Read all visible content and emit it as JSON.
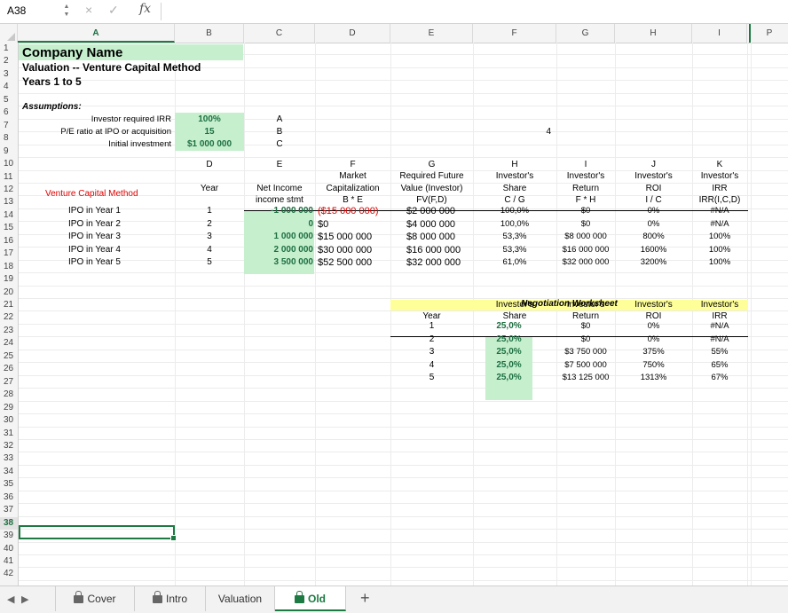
{
  "formula_bar": {
    "name_box": "A38",
    "cancel_icon": "×",
    "enter_icon": "✓",
    "fx_label": "fx",
    "formula": ""
  },
  "columns": [
    "A",
    "B",
    "C",
    "D",
    "E",
    "F",
    "G",
    "H",
    "I",
    "P"
  ],
  "active_column": "A",
  "rows": [
    "1",
    "2",
    "3",
    "4",
    "5",
    "6",
    "7",
    "8",
    "9",
    "10",
    "11",
    "12",
    "13",
    "14",
    "15",
    "16",
    "17",
    "18",
    "19",
    "20",
    "21",
    "22",
    "23",
    "24",
    "25",
    "26",
    "27",
    "28",
    "29",
    "30",
    "31",
    "32",
    "33",
    "34",
    "35",
    "36",
    "37",
    "38",
    "39",
    "40",
    "41",
    "42"
  ],
  "active_row": "38",
  "header": {
    "company": "Company Name",
    "title": "Valuation -- Venture Capital Method",
    "years": "Years 1 to 5"
  },
  "assumptions": {
    "heading": "Assumptions:",
    "items": [
      {
        "label": "Investor required IRR",
        "value": "100%",
        "ref": "A"
      },
      {
        "label": "P/E ratio at IPO or acquisition",
        "value": "15",
        "ref": "B"
      },
      {
        "label": "Initial investment",
        "value": "$1 000 000",
        "ref": "C"
      }
    ],
    "f7_value": "4"
  },
  "vc_table": {
    "letters": [
      "D",
      "E",
      "F",
      "G",
      "H",
      "I",
      "J",
      "K"
    ],
    "section_label": "Venture Capital Method",
    "header_top": [
      "",
      "",
      "Market",
      "Required Future",
      "Investor's",
      "Investor's",
      "Investor's",
      "Investor's"
    ],
    "header_row11": [
      "Year",
      "Net Income",
      "Capitalization",
      "Value (Investor)",
      "Share",
      "Return",
      "ROI",
      "IRR"
    ],
    "header_row12": [
      "",
      "income stmt",
      "B * E",
      "FV(F,D)",
      "C / G",
      "F * H",
      "I / C",
      "IRR(I,C,D)"
    ],
    "rows": [
      {
        "label": "IPO in Year 1",
        "year": "1",
        "net_income": "-1 000 000",
        "market_cap": "($15  000  000)",
        "fv": "$2  000  000",
        "share": "100,0%",
        "return": "$0",
        "roi": "0%",
        "irr": "#N/A"
      },
      {
        "label": "IPO in Year 2",
        "year": "2",
        "net_income": "0",
        "market_cap": "$0",
        "fv": "$4  000  000",
        "share": "100,0%",
        "return": "$0",
        "roi": "0%",
        "irr": "#N/A"
      },
      {
        "label": "IPO in Year 3",
        "year": "3",
        "net_income": "1 000 000",
        "market_cap": "$15  000  000",
        "fv": "$8  000  000",
        "share": "53,3%",
        "return": "$8 000 000",
        "roi": "800%",
        "irr": "100%"
      },
      {
        "label": "IPO in Year 4",
        "year": "4",
        "net_income": "2 000 000",
        "market_cap": "$30  000  000",
        "fv": "$16  000  000",
        "share": "53,3%",
        "return": "$16 000 000",
        "roi": "1600%",
        "irr": "100%"
      },
      {
        "label": "IPO in Year 5",
        "year": "5",
        "net_income": "3 500 000",
        "market_cap": "$52  500  000",
        "fv": "$32  000  000",
        "share": "61,0%",
        "return": "$32 000 000",
        "roi": "3200%",
        "irr": "100%"
      }
    ]
  },
  "negotiation": {
    "title": "Negotiation Worksheet",
    "header_top": [
      "",
      "Investor's",
      "Investor's",
      "Investor's",
      "Investor's"
    ],
    "header": [
      "Year",
      "Share",
      "Return",
      "ROI",
      "IRR"
    ],
    "rows": [
      {
        "year": "1",
        "share": "25,0%",
        "return": "$0",
        "roi": "0%",
        "irr": "#N/A"
      },
      {
        "year": "2",
        "share": "25,0%",
        "return": "$0",
        "roi": "0%",
        "irr": "#N/A"
      },
      {
        "year": "3",
        "share": "25,0%",
        "return": "$3 750 000",
        "roi": "375%",
        "irr": "55%"
      },
      {
        "year": "4",
        "share": "25,0%",
        "return": "$7 500 000",
        "roi": "750%",
        "irr": "65%"
      },
      {
        "year": "5",
        "share": "25,0%",
        "return": "$13 125 000",
        "roi": "1313%",
        "irr": "67%"
      }
    ]
  },
  "tabs": {
    "prev_icon": "◀",
    "next_icon": "▶",
    "items": [
      {
        "label": "Cover",
        "locked": true,
        "active": false
      },
      {
        "label": "Intro",
        "locked": true,
        "active": false
      },
      {
        "label": "Valuation",
        "locked": false,
        "active": false
      },
      {
        "label": "Old",
        "locked": true,
        "active": true
      }
    ],
    "add_icon": "+"
  },
  "colors": {
    "green_fill": "#c6efce",
    "yellow_fill": "#ffff99",
    "accent": "#1d7a43",
    "negative": "#e00000"
  }
}
